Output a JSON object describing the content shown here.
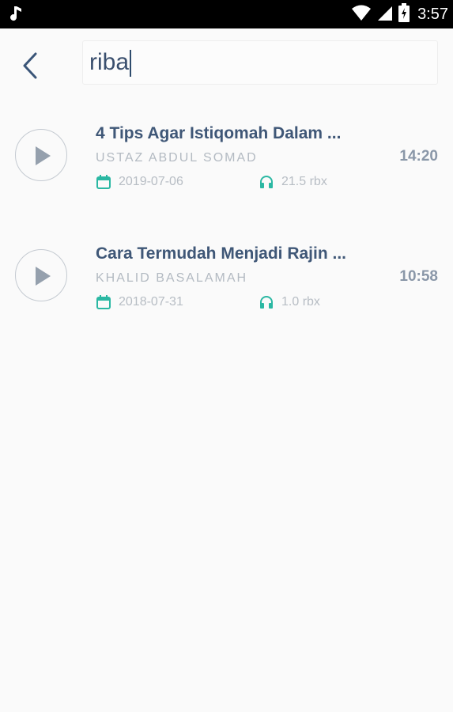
{
  "status_bar": {
    "time": "3:57",
    "icons": [
      "music-note-icon",
      "wifi-icon",
      "signal-icon",
      "battery-icon"
    ]
  },
  "toolbar": {
    "back_icon": "chevron-left-icon",
    "search": {
      "value": "riba",
      "placeholder": ""
    }
  },
  "results": [
    {
      "title": "4 Tips Agar Istiqomah Dalam ...",
      "author": "USTAZ ABDUL SOMAD",
      "date": "2019-07-06",
      "listens": "21.5 rbx",
      "duration": "14:20"
    },
    {
      "title": "Cara Termudah Menjadi Rajin ...",
      "author": "KHALID BASALAMAH",
      "date": "2018-07-31",
      "listens": "1.0 rbx",
      "duration": "10:58"
    }
  ],
  "colors": {
    "title": "#3f5777",
    "meta": "#b7bdc4",
    "accent": "#2bb8a3",
    "status_bar_bg": "#000000"
  }
}
